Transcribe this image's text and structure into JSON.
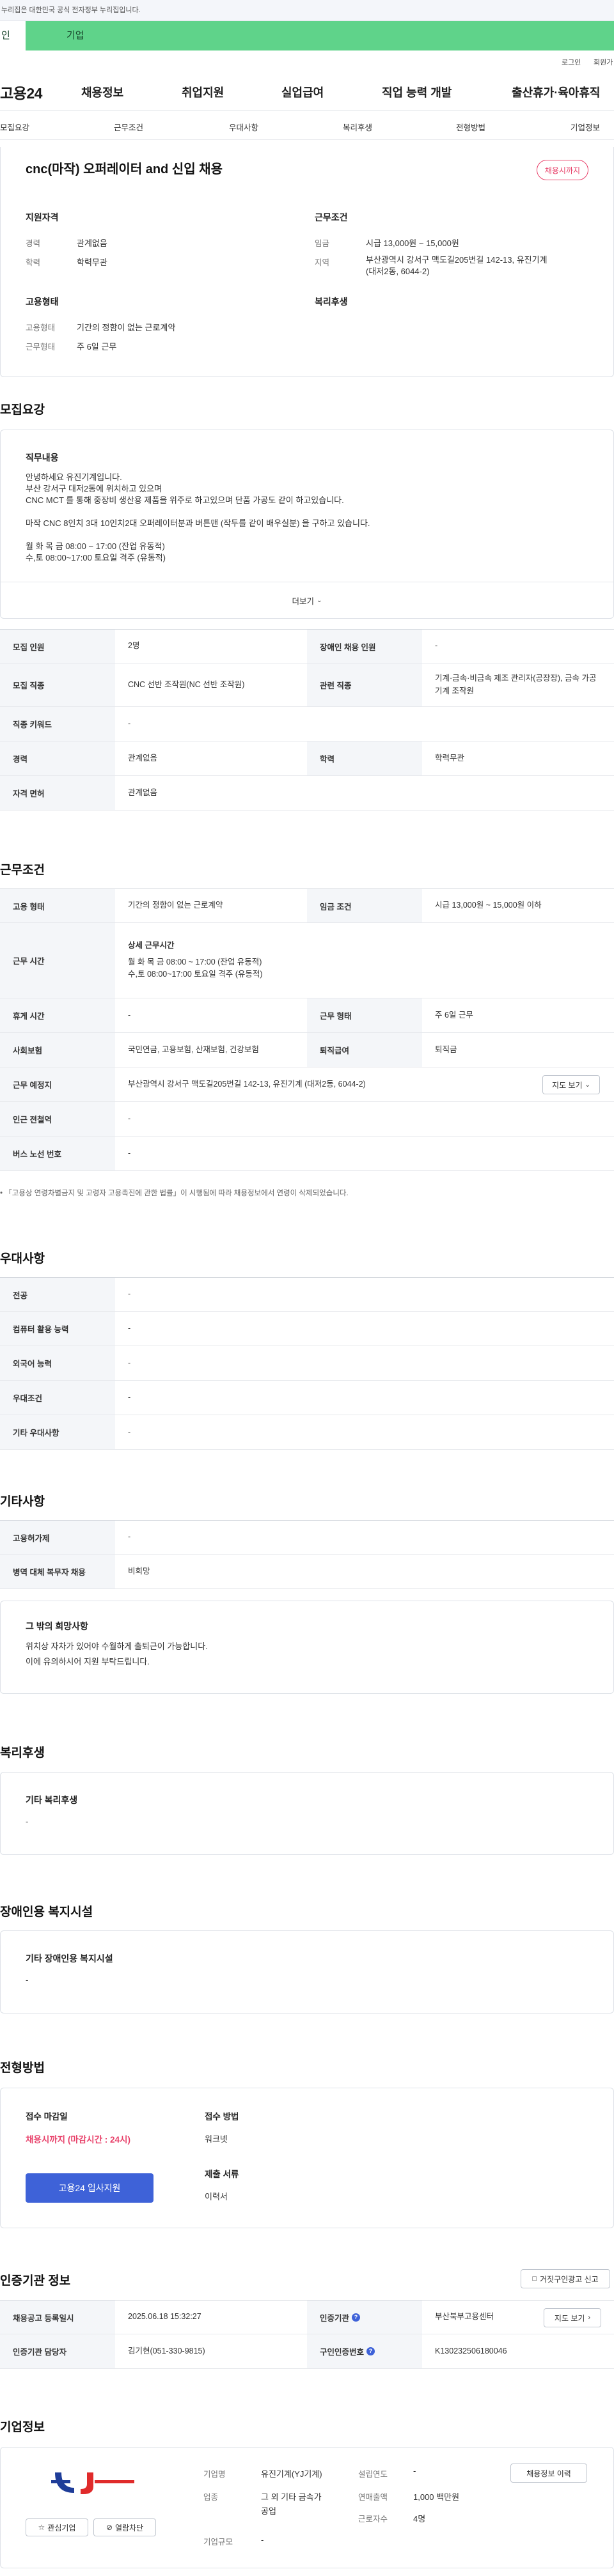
{
  "gov_banner": "누리집은 대한민국 공식 전자정부 누리집입니다.",
  "top_tabs": {
    "person": "인",
    "company": "기업"
  },
  "util": {
    "login": "로그인",
    "join": "회원가"
  },
  "logo": "고용24",
  "gnb": [
    "채용정보",
    "취업지원",
    "실업급여",
    "직업 능력 개발",
    "출산휴가·육아휴직"
  ],
  "anchors": [
    "모집요강",
    "근무조건",
    "우대사항",
    "복리후생",
    "전형방법",
    "기업정보"
  ],
  "summary": {
    "title": "cnc(마작) 오퍼레이터 and 신입 채용",
    "badge": "채용시까지",
    "qual_title": "지원자격",
    "career_l": "경력",
    "career_v": "관계없음",
    "edu_l": "학력",
    "edu_v": "학력무관",
    "cond_title": "근무조건",
    "wage_l": "임금",
    "wage_v": "시급 13,000원 ~ 15,000원",
    "loc_l": "지역",
    "loc_v1": "부산광역시 강서구 맥도길205번길 142-13, 유진기계",
    "loc_v2": "(대저2동, 6044-2)",
    "emp_title": "고용형태",
    "emp_l": "고용형태",
    "emp_v": "기간의 정함이 없는 근로계약",
    "work_l": "근무형태",
    "work_v": "주 6일 근무",
    "welfare_title": "복리후생"
  },
  "recruit": {
    "section": "모집요강",
    "duty_title": "직무내용",
    "duty_lines": [
      "안녕하세요 유진기계입니다.",
      "부산 강서구 대저2동에 위치하고 있으며",
      "CNC MCT 를 통해 중장비 생산용 제품을 위주로 하고있으며 단품 가공도 같이 하고있습니다.",
      "",
      "마작 CNC 8인치 3대 10인치2대  오퍼레이터분과 버튼맨 (작두를 같이 배우실분) 을 구하고 있습니다.",
      "",
      "월 화 목 금 08:00 ~ 17:00 (잔업 유동적)",
      "수,토 08:00~17:00  토요일 격주 (유동적)"
    ],
    "more": "더보기",
    "count_l": "모집 인원",
    "count_v": "2명",
    "disabled_l": "장애인 채용 인원",
    "disabled_v": "-",
    "job_l": "모집 직종",
    "job_v": "CNC 선반 조작원(NC 선반 조작원)",
    "related_l": "관련 직종",
    "related_v": "기계·금속·비금속 제조 관리자(공장장), 금속 가공 기계 조작원",
    "kw_l": "직종 키워드",
    "kw_v": "-",
    "exp_l": "경력",
    "exp_v": "관계없음",
    "edu_l": "학력",
    "edu_v": "학력무관",
    "lic_l": "자격 면허",
    "lic_v": "관계없음"
  },
  "conditions": {
    "section": "근무조건",
    "emp_l": "고용 형태",
    "emp_v": "기간의 정함이 없는 근로계약",
    "wage_l": "임금 조건",
    "wage_v": "시급 13,000원 ~ 15,000원 이하",
    "time_l": "근무 시간",
    "time_title": "상세 근무시간",
    "time_v1": "월 화 목 금 08:00 ~ 17:00 (잔업 유동적)",
    "time_v2": "수,토 08:00~17:00  토요일 격주 (유동적)",
    "rest_l": "휴게 시간",
    "rest_v": "-",
    "form_l": "근무 형태",
    "form_v": "주 6일 근무",
    "ins_l": "사회보험",
    "ins_v": "국민연금, 고용보험, 산재보험, 건강보험",
    "retire_l": "퇴직급여",
    "retire_v": "퇴직금",
    "place_l": "근무 예정지",
    "place_v": "부산광역시 강서구 맥도길205번길 142-13, 유진기계 (대저2동, 6044-2)",
    "map": "지도 보기",
    "subway_l": "인근 전철역",
    "subway_v": "-",
    "bus_l": "버스 노선 번호",
    "bus_v": "-",
    "note": "「고용상 연령차별금지 및 고령자 고용촉진에 관한 법률」이 시행됨에 따라 채용정보에서 연령이 삭제되었습니다."
  },
  "pref": {
    "section": "우대사항",
    "rows": [
      {
        "l": "전공",
        "v": "-"
      },
      {
        "l": "컴퓨터 활용 능력",
        "v": "-"
      },
      {
        "l": "외국어 능력",
        "v": "-"
      },
      {
        "l": "우대조건",
        "v": "-"
      },
      {
        "l": "기타 우대사항",
        "v": "-"
      }
    ]
  },
  "etc": {
    "section": "기타사항",
    "rows": [
      {
        "l": "고용허가제",
        "v": "-"
      },
      {
        "l": "병역 대체 복무자 채용",
        "v": "비희망"
      }
    ],
    "wish_title": "그 밖의 희망사항",
    "wish_lines": [
      "위치상 자차가 있어야 수월하게 출퇴근이 가능합니다.",
      "이에 유의하시어 지원 부탁드립니다."
    ]
  },
  "welfare": {
    "section": "복리후생",
    "title": "기타 복리후생",
    "value": "-"
  },
  "disabled": {
    "section": "장애인용 복지시설",
    "title": "기타 장애인용 복지시설",
    "value": "-"
  },
  "selection": {
    "section": "전형방법",
    "deadline_l": "접수 마감일",
    "deadline_v": "채용시까지 (마감시간 : 24시)",
    "apply_btn": "고용24 입사지원",
    "method_l": "접수 방법",
    "method_v": "워크넷",
    "docs_l": "제출 서류",
    "docs_v": "이력서"
  },
  "agency": {
    "section": "인증기관 정보",
    "report_btn": "거짓구인광고 신고",
    "reg_l": "채용공고 등록일시",
    "reg_v": "2025.06.18 15:32:27",
    "org_l": "인증기관",
    "org_v": "부산북부고용센터",
    "map": "지도 보기",
    "mgr_l": "인증기관 담당자",
    "mgr_v": "김기현(051-330-9815)",
    "no_l": "구인인증번호",
    "no_v": "K130232506180046"
  },
  "company": {
    "section": "기업정보",
    "fav": "관심기업",
    "block": "열람차단",
    "name_l": "기업명",
    "name_v": "유진기계(YJ기계)",
    "year_l": "설립연도",
    "year_v": "-",
    "hist_btn": "채용정보 이력",
    "ind_l": "업종",
    "ind_v1": "그 외 기타 금속가",
    "ind_v2": "공업",
    "sales_l": "연매출액",
    "sales_v": "1,000 백만원",
    "emp_l": "근로자수",
    "emp_v": "4명",
    "scale_l": "기업규모",
    "scale_v": "-"
  },
  "colors": {
    "green": "#5fd38a",
    "accent": "#e8416a",
    "primary": "#3e62d8"
  }
}
